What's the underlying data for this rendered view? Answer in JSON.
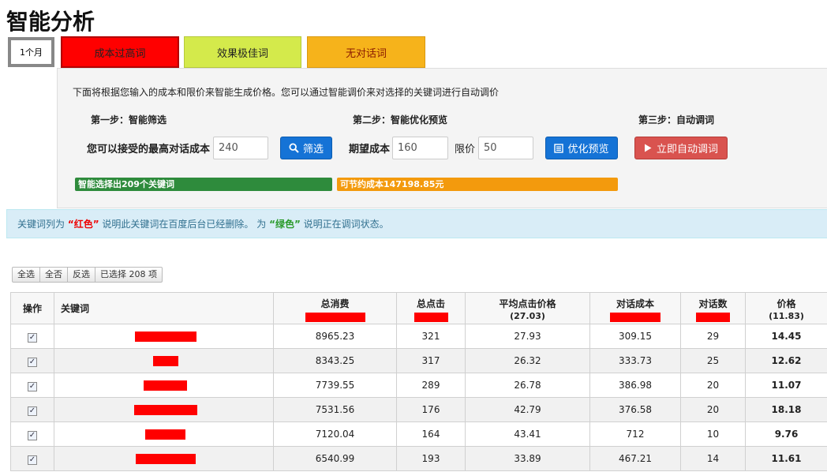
{
  "title": "智能分析",
  "tabs": {
    "period": "1个月",
    "cost_high": "成本过高词",
    "best": "效果极佳词",
    "no_conv": "无对话词"
  },
  "panel": {
    "description": "下面将根据您输入的成本和限价来智能生成价格。您可以通过智能调价来对选择的关键词进行自动调价",
    "step1": "第一步：智能筛选",
    "step2": "第二步：智能优化预览",
    "step3": "第三步：自动调词",
    "max_cost_label": "您可以接受的最高对话成本",
    "max_cost_value": "240",
    "filter_button": "筛选",
    "expected_cost_label": "期望成本",
    "expected_cost_value": "160",
    "limit_label": "限价",
    "limit_value": "50",
    "preview_button": "优化预览",
    "auto_button": "立即自动调词",
    "green_bar": "智能选择出209个关键词",
    "orange_bar": "可节约成本147198.85元"
  },
  "notice": {
    "p1": "关键词列为 ",
    "red_word": "“红色”",
    "p2": " 说明此关键词在百度后台已经删除。 为 ",
    "green_word": "“绿色”",
    "p3": " 说明正在调词状态。"
  },
  "selection": {
    "all": "全选",
    "none": "全否",
    "invert": "反选",
    "selected": "已选择 208 项"
  },
  "table": {
    "headers": {
      "op": "操作",
      "keyword": "关键词",
      "spend": "总消费",
      "clicks": "总点击",
      "avg_cpc": "平均点击价格",
      "avg_cpc_sub": "(27.03)",
      "conv_cost": "对话成本",
      "conv_count": "对话数",
      "price": "价格",
      "price_sub": "(11.83)"
    },
    "rows": [
      {
        "spend": "8965.23",
        "clicks": "321",
        "avg_cpc": "27.93",
        "conv_cost": "309.15",
        "conv_count": "29",
        "price": "14.45"
      },
      {
        "spend": "8343.25",
        "clicks": "317",
        "avg_cpc": "26.32",
        "conv_cost": "333.73",
        "conv_count": "25",
        "price": "12.62"
      },
      {
        "spend": "7739.55",
        "clicks": "289",
        "avg_cpc": "26.78",
        "conv_cost": "386.98",
        "conv_count": "20",
        "price": "11.07"
      },
      {
        "spend": "7531.56",
        "clicks": "176",
        "avg_cpc": "42.79",
        "conv_cost": "376.58",
        "conv_count": "20",
        "price": "18.18"
      },
      {
        "spend": "7120.04",
        "clicks": "164",
        "avg_cpc": "43.41",
        "conv_cost": "712",
        "conv_count": "10",
        "price": "9.76"
      },
      {
        "spend": "6540.99",
        "clicks": "193",
        "avg_cpc": "33.89",
        "conv_cost": "467.21",
        "conv_count": "14",
        "price": "11.61"
      }
    ]
  },
  "icons": {
    "search": "search-icon",
    "list": "list-icon",
    "play": "play-icon",
    "checkbox": "checkbox-checked-icon"
  },
  "colors": {
    "tab_red": "#ff0000",
    "tab_lime": "#d4ea4b",
    "tab_orange": "#f6b31b",
    "button_blue": "#1573d6",
    "button_red": "#d9534f",
    "bar_green": "#2e8b3c",
    "bar_orange": "#f39a0d"
  }
}
